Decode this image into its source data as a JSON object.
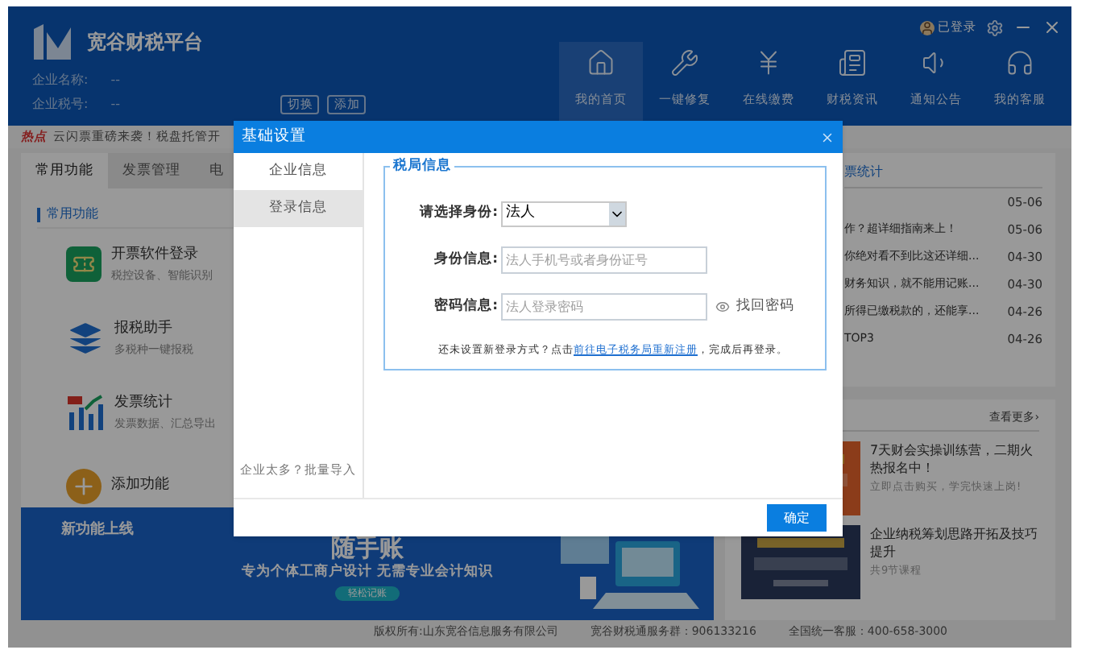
{
  "app": {
    "title": "宽谷财税平台",
    "company_name_label": "企业名称:",
    "company_name": "--",
    "tax_id_label": "企业税号:",
    "tax_id": "--",
    "buttons": [
      "切换",
      "添加"
    ],
    "user_status": "已登录"
  },
  "nav": [
    {
      "label": "我的首页",
      "kind": "home",
      "selected": true
    },
    {
      "label": "一键修复",
      "kind": "repair",
      "selected": false
    },
    {
      "label": "在线缴费",
      "kind": "pay",
      "selected": false
    },
    {
      "label": "财税资讯",
      "kind": "news",
      "selected": false
    },
    {
      "label": "通知公告",
      "kind": "notice",
      "selected": false
    },
    {
      "label": "我的客服",
      "kind": "service",
      "selected": false
    }
  ],
  "notice": {
    "tag": "热点",
    "text": "云闪票重磅来袭！税盘托管开"
  },
  "tabs": [
    {
      "label": "常用功能",
      "selected": true
    },
    {
      "label": "发票管理",
      "selected": false
    },
    {
      "label": "电",
      "selected": false
    }
  ],
  "section_title": "常用功能",
  "features": [
    {
      "kind": "invoice",
      "title": "开票软件登录",
      "subtitle": "税控设备、智能识别"
    },
    {
      "kind": "layers",
      "title": "报税助手",
      "subtitle": "多税种一键报税"
    },
    {
      "kind": "chart",
      "title": "发票统计",
      "subtitle": "发票数据、汇总导出"
    },
    {
      "kind": "add",
      "title": "添加功能"
    }
  ],
  "banner": {
    "tag": "新功能上线",
    "title": "随手账",
    "subtitle": "专为个体工商户设计 无需专业会计知识",
    "button": "轻松记账"
  },
  "news": {
    "title": "票统计",
    "items": [
      {
        "date": "05-06"
      },
      {
        "title": "作？超详细指南来上！",
        "date": "05-06"
      },
      {
        "title": "你绝对看不到比这还详细...",
        "date": "04-30"
      },
      {
        "title": "财务知识，就不能用记账...",
        "date": "04-30"
      },
      {
        "title": "所得已缴税款的，还能享...",
        "date": "04-26"
      },
      {
        "title": "TOP3",
        "date": "04-26"
      }
    ]
  },
  "courses": {
    "more": "查看更多›",
    "items": [
      {
        "title": "7天财会实操训练营，二期火热报名中！",
        "subtitle": "立即点击购买，学完快速上岗!"
      },
      {
        "title": "企业纳税筹划思路开拓及技巧提升",
        "subtitle": "共9节课程"
      }
    ]
  },
  "footer": [
    "版权所有:山东宽谷信息服务有限公司",
    "宽谷财税通服务群：906133216",
    "全国统一客服：400-658-3000"
  ],
  "dialog": {
    "title": "基础设置",
    "nav": [
      {
        "label": "企业信息",
        "selected": false
      },
      {
        "label": "登录信息",
        "selected": true
      }
    ],
    "batch_import": "企业太多？批量导入",
    "group_title": "税局信息",
    "fields": [
      {
        "kind": "select",
        "label": "请选择身份:",
        "value": "法人"
      },
      {
        "kind": "text",
        "label": "身份信息:",
        "placeholder": "法人手机号或者身份证号"
      },
      {
        "kind": "password",
        "label": "密码信息:",
        "placeholder": "法人登录密码",
        "action": "找回密码"
      }
    ],
    "hint": {
      "before": "还未设置新登录方式？点击",
      "link": "前往电子税务局重新注册",
      "after": "，完成后再登录。"
    },
    "confirm": "确定"
  }
}
